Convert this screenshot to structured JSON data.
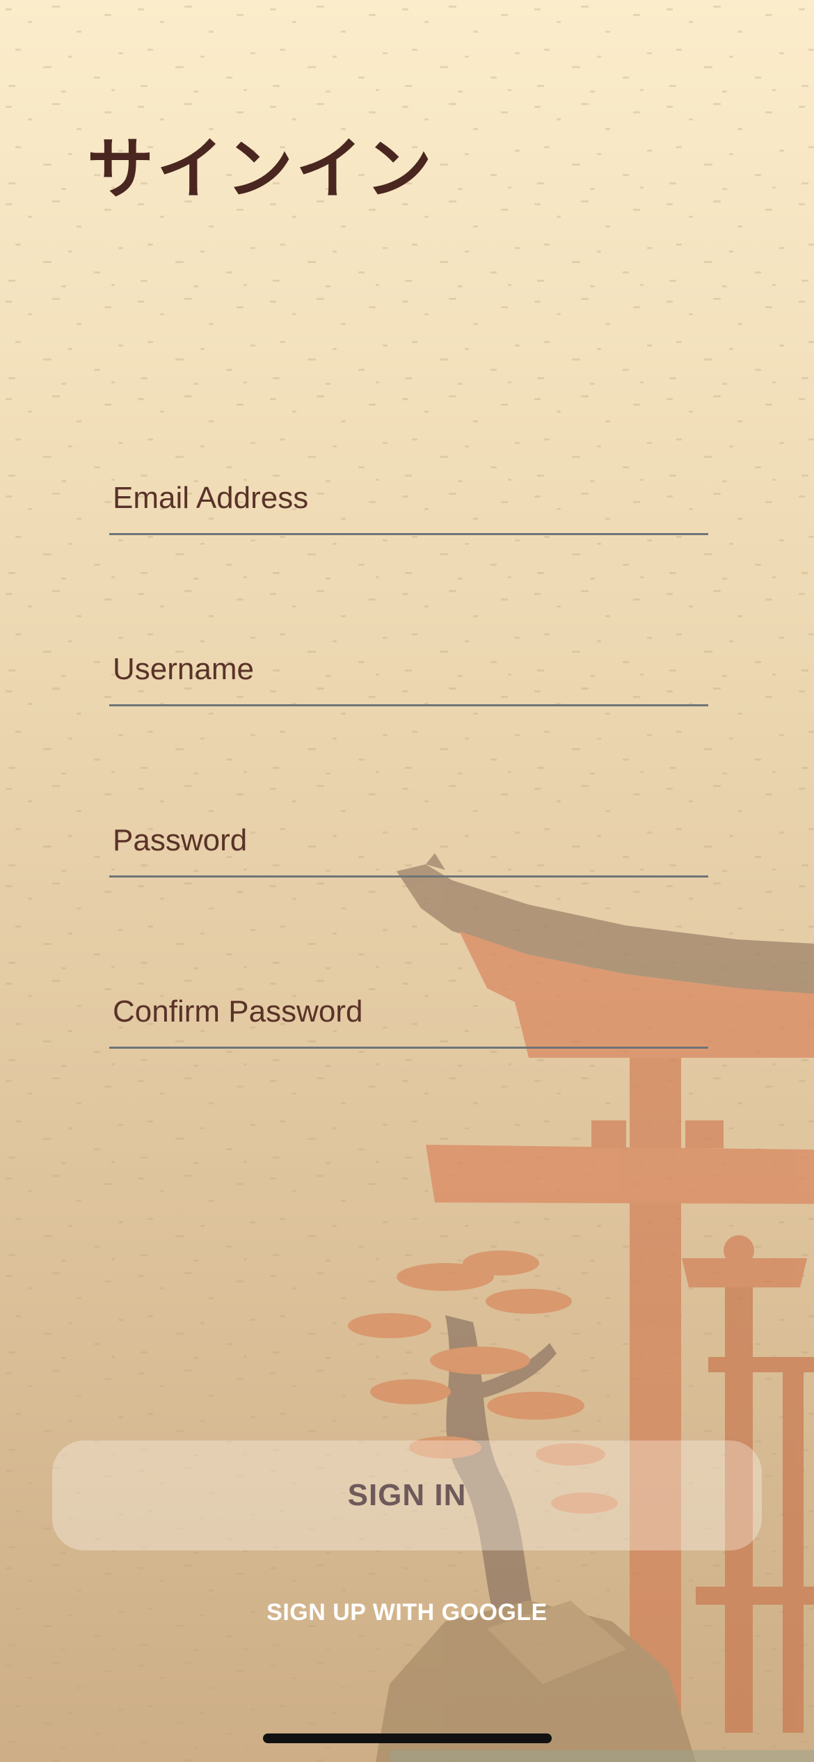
{
  "screen": {
    "title": "サインイン"
  },
  "form": {
    "email_placeholder": "Email Address",
    "username_placeholder": "Username",
    "password_placeholder": "Password",
    "confirm_password_placeholder": "Confirm Password"
  },
  "actions": {
    "sign_in_label": "SIGN IN",
    "google_label": "SIGN UP WITH GOOGLE"
  },
  "colors": {
    "background_top": "#fbeccb",
    "background_bottom": "#cdae86",
    "title_text": "#4a2620",
    "field_underline": "#6e7478",
    "torii_gate": "#d9875f"
  }
}
